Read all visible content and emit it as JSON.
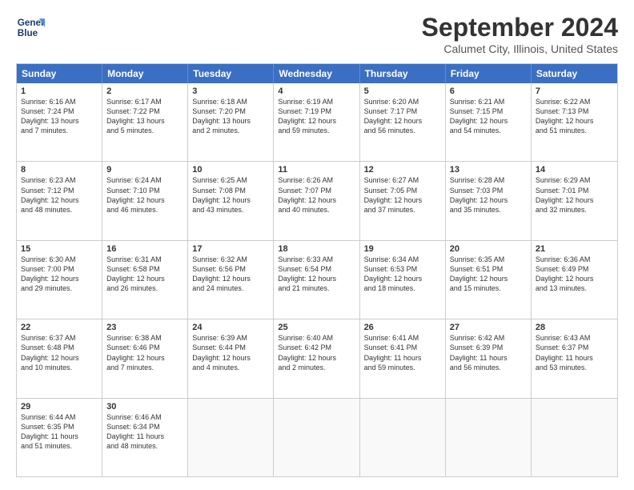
{
  "header": {
    "logo_line1": "General",
    "logo_line2": "Blue",
    "title": "September 2024",
    "subtitle": "Calumet City, Illinois, United States"
  },
  "calendar": {
    "headers": [
      "Sunday",
      "Monday",
      "Tuesday",
      "Wednesday",
      "Thursday",
      "Friday",
      "Saturday"
    ],
    "rows": [
      [
        {
          "day": "1",
          "l1": "Sunrise: 6:16 AM",
          "l2": "Sunset: 7:24 PM",
          "l3": "Daylight: 13 hours",
          "l4": "and 7 minutes."
        },
        {
          "day": "2",
          "l1": "Sunrise: 6:17 AM",
          "l2": "Sunset: 7:22 PM",
          "l3": "Daylight: 13 hours",
          "l4": "and 5 minutes."
        },
        {
          "day": "3",
          "l1": "Sunrise: 6:18 AM",
          "l2": "Sunset: 7:20 PM",
          "l3": "Daylight: 13 hours",
          "l4": "and 2 minutes."
        },
        {
          "day": "4",
          "l1": "Sunrise: 6:19 AM",
          "l2": "Sunset: 7:19 PM",
          "l3": "Daylight: 12 hours",
          "l4": "and 59 minutes."
        },
        {
          "day": "5",
          "l1": "Sunrise: 6:20 AM",
          "l2": "Sunset: 7:17 PM",
          "l3": "Daylight: 12 hours",
          "l4": "and 56 minutes."
        },
        {
          "day": "6",
          "l1": "Sunrise: 6:21 AM",
          "l2": "Sunset: 7:15 PM",
          "l3": "Daylight: 12 hours",
          "l4": "and 54 minutes."
        },
        {
          "day": "7",
          "l1": "Sunrise: 6:22 AM",
          "l2": "Sunset: 7:13 PM",
          "l3": "Daylight: 12 hours",
          "l4": "and 51 minutes."
        }
      ],
      [
        {
          "day": "8",
          "l1": "Sunrise: 6:23 AM",
          "l2": "Sunset: 7:12 PM",
          "l3": "Daylight: 12 hours",
          "l4": "and 48 minutes."
        },
        {
          "day": "9",
          "l1": "Sunrise: 6:24 AM",
          "l2": "Sunset: 7:10 PM",
          "l3": "Daylight: 12 hours",
          "l4": "and 46 minutes."
        },
        {
          "day": "10",
          "l1": "Sunrise: 6:25 AM",
          "l2": "Sunset: 7:08 PM",
          "l3": "Daylight: 12 hours",
          "l4": "and 43 minutes."
        },
        {
          "day": "11",
          "l1": "Sunrise: 6:26 AM",
          "l2": "Sunset: 7:07 PM",
          "l3": "Daylight: 12 hours",
          "l4": "and 40 minutes."
        },
        {
          "day": "12",
          "l1": "Sunrise: 6:27 AM",
          "l2": "Sunset: 7:05 PM",
          "l3": "Daylight: 12 hours",
          "l4": "and 37 minutes."
        },
        {
          "day": "13",
          "l1": "Sunrise: 6:28 AM",
          "l2": "Sunset: 7:03 PM",
          "l3": "Daylight: 12 hours",
          "l4": "and 35 minutes."
        },
        {
          "day": "14",
          "l1": "Sunrise: 6:29 AM",
          "l2": "Sunset: 7:01 PM",
          "l3": "Daylight: 12 hours",
          "l4": "and 32 minutes."
        }
      ],
      [
        {
          "day": "15",
          "l1": "Sunrise: 6:30 AM",
          "l2": "Sunset: 7:00 PM",
          "l3": "Daylight: 12 hours",
          "l4": "and 29 minutes."
        },
        {
          "day": "16",
          "l1": "Sunrise: 6:31 AM",
          "l2": "Sunset: 6:58 PM",
          "l3": "Daylight: 12 hours",
          "l4": "and 26 minutes."
        },
        {
          "day": "17",
          "l1": "Sunrise: 6:32 AM",
          "l2": "Sunset: 6:56 PM",
          "l3": "Daylight: 12 hours",
          "l4": "and 24 minutes."
        },
        {
          "day": "18",
          "l1": "Sunrise: 6:33 AM",
          "l2": "Sunset: 6:54 PM",
          "l3": "Daylight: 12 hours",
          "l4": "and 21 minutes."
        },
        {
          "day": "19",
          "l1": "Sunrise: 6:34 AM",
          "l2": "Sunset: 6:53 PM",
          "l3": "Daylight: 12 hours",
          "l4": "and 18 minutes."
        },
        {
          "day": "20",
          "l1": "Sunrise: 6:35 AM",
          "l2": "Sunset: 6:51 PM",
          "l3": "Daylight: 12 hours",
          "l4": "and 15 minutes."
        },
        {
          "day": "21",
          "l1": "Sunrise: 6:36 AM",
          "l2": "Sunset: 6:49 PM",
          "l3": "Daylight: 12 hours",
          "l4": "and 13 minutes."
        }
      ],
      [
        {
          "day": "22",
          "l1": "Sunrise: 6:37 AM",
          "l2": "Sunset: 6:48 PM",
          "l3": "Daylight: 12 hours",
          "l4": "and 10 minutes."
        },
        {
          "day": "23",
          "l1": "Sunrise: 6:38 AM",
          "l2": "Sunset: 6:46 PM",
          "l3": "Daylight: 12 hours",
          "l4": "and 7 minutes."
        },
        {
          "day": "24",
          "l1": "Sunrise: 6:39 AM",
          "l2": "Sunset: 6:44 PM",
          "l3": "Daylight: 12 hours",
          "l4": "and 4 minutes."
        },
        {
          "day": "25",
          "l1": "Sunrise: 6:40 AM",
          "l2": "Sunset: 6:42 PM",
          "l3": "Daylight: 12 hours",
          "l4": "and 2 minutes."
        },
        {
          "day": "26",
          "l1": "Sunrise: 6:41 AM",
          "l2": "Sunset: 6:41 PM",
          "l3": "Daylight: 11 hours",
          "l4": "and 59 minutes."
        },
        {
          "day": "27",
          "l1": "Sunrise: 6:42 AM",
          "l2": "Sunset: 6:39 PM",
          "l3": "Daylight: 11 hours",
          "l4": "and 56 minutes."
        },
        {
          "day": "28",
          "l1": "Sunrise: 6:43 AM",
          "l2": "Sunset: 6:37 PM",
          "l3": "Daylight: 11 hours",
          "l4": "and 53 minutes."
        }
      ],
      [
        {
          "day": "29",
          "l1": "Sunrise: 6:44 AM",
          "l2": "Sunset: 6:35 PM",
          "l3": "Daylight: 11 hours",
          "l4": "and 51 minutes."
        },
        {
          "day": "30",
          "l1": "Sunrise: 6:46 AM",
          "l2": "Sunset: 6:34 PM",
          "l3": "Daylight: 11 hours",
          "l4": "and 48 minutes."
        },
        {
          "day": "",
          "l1": "",
          "l2": "",
          "l3": "",
          "l4": ""
        },
        {
          "day": "",
          "l1": "",
          "l2": "",
          "l3": "",
          "l4": ""
        },
        {
          "day": "",
          "l1": "",
          "l2": "",
          "l3": "",
          "l4": ""
        },
        {
          "day": "",
          "l1": "",
          "l2": "",
          "l3": "",
          "l4": ""
        },
        {
          "day": "",
          "l1": "",
          "l2": "",
          "l3": "",
          "l4": ""
        }
      ]
    ]
  }
}
